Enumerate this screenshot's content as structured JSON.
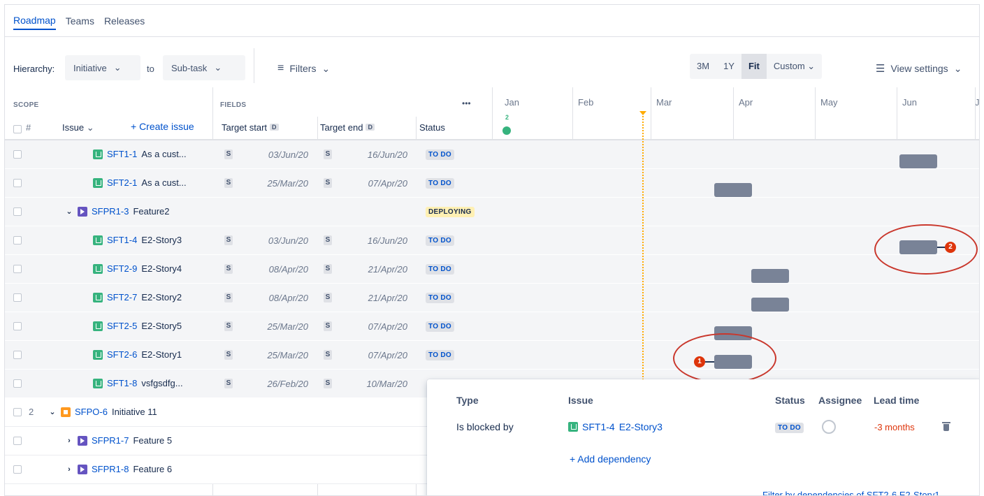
{
  "tabs": [
    "Roadmap",
    "Teams",
    "Releases"
  ],
  "toolbar": {
    "hierarchy_label": "Hierarchy:",
    "from_value": "Initiative",
    "to_label": "to",
    "to_value": "Sub-task",
    "filters_label": "Filters",
    "zoom_options": [
      "3M",
      "1Y",
      "Fit",
      "Custom"
    ],
    "zoom_selected": "Fit",
    "view_settings_label": "View settings"
  },
  "header": {
    "scope_label": "SCOPE",
    "fields_label": "FIELDS",
    "more": "•••",
    "hash": "#",
    "issue_label": "Issue",
    "create_issue_label": "+ Create issue",
    "target_start": "Target start",
    "target_end": "Target end",
    "d_badge": "D",
    "status_label": "Status",
    "months": [
      "Jan",
      "Feb",
      "Mar",
      "Apr",
      "May",
      "Jun",
      "J"
    ],
    "release_count": "2"
  },
  "rows": [
    {
      "key": "SFT1-1",
      "summary": "As a cust...",
      "type": "story",
      "start": "03/Jun/20",
      "end": "16/Jun/20",
      "status": "TO DO"
    },
    {
      "key": "SFT2-1",
      "summary": "As a cust...",
      "type": "story",
      "start": "25/Mar/20",
      "end": "07/Apr/20",
      "status": "TO DO"
    },
    {
      "key": "SFPR1-3",
      "summary": "Feature2",
      "type": "feature",
      "start": "",
      "end": "",
      "status": "DEPLOYING"
    },
    {
      "key": "SFT1-4",
      "summary": "E2-Story3",
      "type": "story",
      "start": "03/Jun/20",
      "end": "16/Jun/20",
      "status": "TO DO"
    },
    {
      "key": "SFT2-9",
      "summary": "E2-Story4",
      "type": "story",
      "start": "08/Apr/20",
      "end": "21/Apr/20",
      "status": "TO DO"
    },
    {
      "key": "SFT2-7",
      "summary": "E2-Story2",
      "type": "story",
      "start": "08/Apr/20",
      "end": "21/Apr/20",
      "status": "TO DO"
    },
    {
      "key": "SFT2-5",
      "summary": "E2-Story5",
      "type": "story",
      "start": "25/Mar/20",
      "end": "07/Apr/20",
      "status": "TO DO"
    },
    {
      "key": "SFT2-6",
      "summary": "E2-Story1",
      "type": "story",
      "start": "25/Mar/20",
      "end": "07/Apr/20",
      "status": "TO DO"
    },
    {
      "key": "SFT1-8",
      "summary": "vsfgsdfg...",
      "type": "story",
      "start": "26/Feb/20",
      "end": "10/Mar/20",
      "status": ""
    },
    {
      "key": "SFPO-6",
      "summary": "Initiative 11",
      "type": "initiative",
      "count": "2",
      "start": "",
      "end": "",
      "status": ""
    },
    {
      "key": "SFPR1-7",
      "summary": "Feature 5",
      "type": "feature",
      "start": "",
      "end": "",
      "status": ""
    },
    {
      "key": "SFPR1-8",
      "summary": "Feature 6",
      "type": "feature",
      "start": "",
      "end": "",
      "status": ""
    }
  ],
  "s_badge": "S",
  "markers": {
    "incoming": "1",
    "outgoing": "2"
  },
  "popup": {
    "col_type": "Type",
    "col_issue": "Issue",
    "col_status": "Status",
    "col_assignee": "Assignee",
    "col_lead_time": "Lead time",
    "type_value": "Is blocked by",
    "issue_key": "SFT1-4",
    "issue_summary": "E2-Story3",
    "status_value": "TO DO",
    "lead_time_value": "-3 months",
    "add_dependency": "+ Add dependency",
    "filter_link": "Filter by dependencies of SFT2-6 E2-Story1"
  },
  "colors": {
    "accent": "#0052cc",
    "story": "#36b37e",
    "feature": "#6554c0",
    "initiative": "#ff991f",
    "danger": "#de350b",
    "annotation": "#c9372c"
  }
}
